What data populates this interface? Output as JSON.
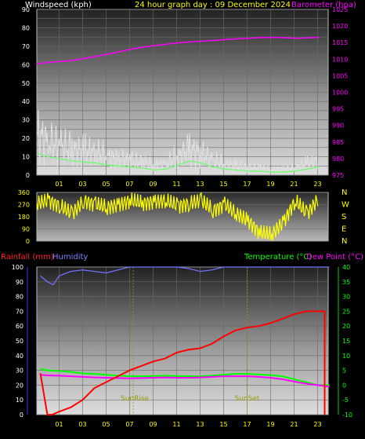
{
  "header": {
    "windspeed_label": "Windspeed (kph)",
    "title": "24 hour graph day : 09 December 2024",
    "barometer_label": "Barometer (hpa)"
  },
  "legend_bottom": {
    "rainfall_label": "Rainfall (mm)",
    "humidity_label": "Humidity",
    "temperature_label": "Temperature (°C)",
    "dewpoint_label": "Dew Point (°C)"
  },
  "colors": {
    "windspeed": "#ffffff",
    "gust": "#e0e0e0",
    "avg_wind": "#66ff66",
    "barometer": "#ff00ff",
    "direction": "#ffff00",
    "rainfall": "#ff0000",
    "humidity": "#7070ff",
    "temperature": "#00ff00",
    "dewpoint": "#ff00ff",
    "header_title": "#ffff00",
    "sun_marker": "#999900"
  },
  "chart_data": [
    {
      "type": "line",
      "title": "24 hour graph day : 09 December 2024",
      "xlabel": "",
      "ylabel": "Windspeed (kph)",
      "y2label": "Barometer (hpa)",
      "x_ticks": [
        "01",
        "03",
        "05",
        "07",
        "09",
        "11",
        "13",
        "15",
        "17",
        "19",
        "21",
        "23"
      ],
      "ylim": [
        0,
        90
      ],
      "y_ticks": [
        0,
        5,
        10,
        15,
        20,
        25,
        30,
        35,
        40,
        45,
        50,
        55,
        60,
        65,
        70,
        75,
        80,
        85,
        90
      ],
      "y2lim": [
        975,
        1025
      ],
      "y2_ticks": [
        975,
        980,
        985,
        990,
        995,
        1000,
        1005,
        1010,
        1015,
        1020,
        1025
      ],
      "grid": true,
      "series": [
        {
          "name": "Windspeed (kph)",
          "axis": "y",
          "x": [
            0,
            1,
            2,
            3,
            4,
            5,
            6,
            7,
            8,
            9,
            10,
            11,
            12,
            13,
            14,
            15,
            16,
            17,
            18,
            19,
            20,
            21,
            22,
            23,
            24
          ],
          "values": [
            22,
            18,
            16,
            14,
            13,
            12,
            10,
            9,
            8,
            7,
            5,
            6,
            10,
            14,
            12,
            8,
            6,
            5,
            4,
            4,
            3,
            3,
            4,
            6,
            8
          ]
        },
        {
          "name": "Barometer (hpa)",
          "axis": "y2",
          "x": [
            0,
            1,
            2,
            3,
            4,
            5,
            6,
            7,
            8,
            9,
            10,
            11,
            12,
            13,
            14,
            15,
            16,
            17,
            18,
            19,
            20,
            21,
            22,
            23,
            24
          ],
          "values": [
            1008.6,
            1009.0,
            1009.3,
            1009.6,
            1010.2,
            1010.8,
            1011.5,
            1012.2,
            1013.0,
            1013.6,
            1014.1,
            1014.5,
            1014.9,
            1015.2,
            1015.4,
            1015.6,
            1015.9,
            1016.1,
            1016.3,
            1016.5,
            1016.6,
            1016.5,
            1016.3,
            1016.4,
            1016.6
          ]
        }
      ]
    },
    {
      "type": "line",
      "title": "",
      "ylim": [
        0,
        360
      ],
      "y_ticks": [
        0,
        90,
        180,
        270,
        360
      ],
      "compass_labels": [
        "N",
        "W",
        "S",
        "E",
        "N"
      ],
      "series": [
        {
          "name": "Wind Direction",
          "x": [
            0,
            1,
            2,
            3,
            4,
            5,
            6,
            7,
            8,
            9,
            10,
            11,
            12,
            13,
            14,
            15,
            16,
            17,
            18,
            19,
            20,
            21,
            22,
            23,
            24
          ],
          "values": [
            280,
            300,
            260,
            200,
            300,
            270,
            250,
            270,
            300,
            280,
            290,
            300,
            260,
            280,
            300,
            230,
            270,
            200,
            150,
            60,
            50,
            140,
            300,
            200,
            320
          ]
        }
      ]
    },
    {
      "type": "line",
      "title": "",
      "x_ticks": [
        "01",
        "03",
        "05",
        "07",
        "09",
        "11",
        "13",
        "15",
        "17",
        "19",
        "21",
        "23"
      ],
      "ylim": [
        0,
        100
      ],
      "y_ticks": [
        0,
        10,
        20,
        30,
        40,
        50,
        60,
        70,
        80,
        90,
        100
      ],
      "y2lim": [
        -10,
        40
      ],
      "y2_ticks": [
        -10,
        -5,
        0,
        5,
        10,
        15,
        20,
        25,
        30,
        35,
        40
      ],
      "annotations": [
        {
          "label": "SunRise",
          "x": 7.3
        },
        {
          "label": "SunSet",
          "x": 17.0
        }
      ],
      "series": [
        {
          "name": "Rainfall (mm)",
          "axis": "y",
          "x": [
            -0.6,
            0,
            0.4,
            1,
            2,
            3,
            4,
            5,
            6,
            7,
            8,
            9,
            10,
            11,
            12,
            13,
            14,
            15,
            16,
            17,
            18,
            19,
            20,
            21,
            22,
            23,
            23.6,
            23.6
          ],
          "values": [
            28,
            0,
            0,
            2,
            5,
            10,
            18,
            22,
            26,
            30,
            33,
            36,
            38,
            42,
            44,
            45,
            48,
            53,
            57,
            59,
            60,
            62,
            65,
            68,
            70,
            70,
            70,
            0
          ]
        },
        {
          "name": "Humidity",
          "axis": "y",
          "x": [
            -0.6,
            0,
            0.5,
            1,
            2,
            3,
            4,
            5,
            6,
            7,
            8,
            9,
            10,
            11,
            12,
            13,
            14,
            15,
            16,
            17,
            18,
            19,
            20,
            21,
            22,
            23,
            24
          ],
          "values": [
            94,
            90,
            88,
            94,
            97,
            98,
            97,
            96,
            98,
            100,
            100,
            100,
            100,
            100,
            99,
            97,
            98,
            100,
            100,
            100,
            100,
            100,
            100,
            100,
            100,
            100,
            100
          ]
        },
        {
          "name": "Temperature (°C)",
          "axis": "y2",
          "x": [
            -0.6,
            0,
            1,
            2,
            3,
            4,
            5,
            6,
            7,
            8,
            9,
            10,
            11,
            12,
            13,
            14,
            15,
            16,
            17,
            18,
            19,
            20,
            21,
            22,
            23,
            24
          ],
          "values": [
            5.5,
            5,
            4.8,
            4.5,
            4,
            3.8,
            3.5,
            3.2,
            3,
            3,
            3.1,
            3.2,
            3.1,
            3,
            3,
            3.2,
            3.5,
            3.8,
            3.8,
            3.6,
            3.4,
            3,
            2,
            1,
            0,
            0
          ]
        },
        {
          "name": "Dew Point (°C)",
          "axis": "y2",
          "x": [
            -0.6,
            0,
            1,
            2,
            3,
            4,
            5,
            6,
            7,
            8,
            9,
            10,
            11,
            12,
            13,
            14,
            15,
            16,
            17,
            18,
            19,
            20,
            21,
            22,
            23,
            24
          ],
          "values": [
            3.5,
            3.3,
            3.2,
            3,
            2.8,
            2.6,
            2.5,
            2.4,
            2.3,
            2.4,
            2.5,
            2.6,
            2.5,
            2.5,
            2.6,
            2.8,
            3,
            3,
            3,
            2.8,
            2.5,
            2,
            1.2,
            0.5,
            0,
            -0.5
          ]
        }
      ]
    }
  ]
}
